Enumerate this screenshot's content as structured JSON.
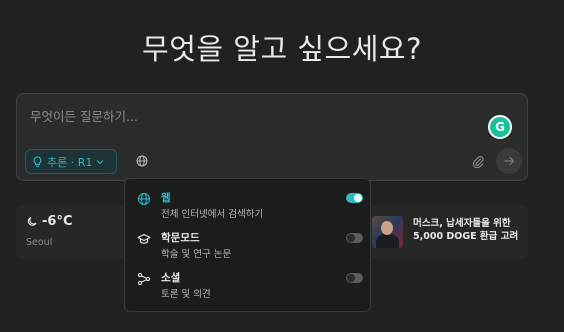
{
  "headline": "무엇을 알고 싶으세요?",
  "composer": {
    "placeholder": "무엇이든 질문하기...",
    "mode_label": "추론 · R1"
  },
  "weather": {
    "temperature": "-6°C",
    "city": "Seoul"
  },
  "news": {
    "title": "머스크, 납세자들을 위한 5,000 DOGE 환급 고려"
  },
  "source_menu": {
    "options": [
      {
        "title": "웹",
        "description": "전체 인터넷에서 검색하기",
        "enabled": true,
        "icon": "globe-icon"
      },
      {
        "title": "학문모드",
        "description": "학술 및 연구 논문",
        "enabled": false,
        "icon": "graduation-cap-icon"
      },
      {
        "title": "소셜",
        "description": "토론 및 의견",
        "enabled": false,
        "icon": "social-network-icon"
      }
    ]
  },
  "colors": {
    "background": "#202222",
    "accent": "#2fb8c6",
    "grammarly": "#15c39a"
  }
}
